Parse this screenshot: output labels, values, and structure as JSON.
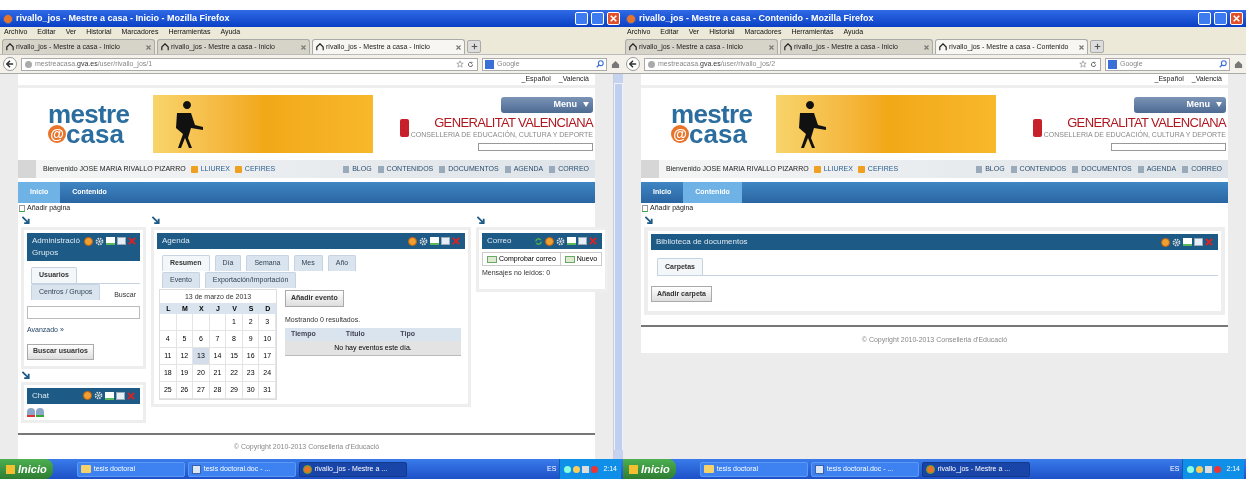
{
  "windows": [
    {
      "title": "rivallo_jos - Mestre a casa - Inicio - Mozilla Firefox",
      "menu": [
        "Archivo",
        "Editar",
        "Ver",
        "Historial",
        "Marcadores",
        "Herramientas",
        "Ayuda"
      ],
      "tabs": [
        {
          "label": "rivallo_jos - Mestre a casa - Inicio",
          "selected": false
        },
        {
          "label": "rivallo_jos - Mestre a casa - Inicio",
          "selected": false
        },
        {
          "label": "rivallo_jos - Mestre a casa - Inicio",
          "selected": true
        }
      ],
      "url": "mestreacasa.**gva.es**/user/rivallo_jos/1",
      "search_placeholder": "Google",
      "languages": [
        "_Español",
        "_Valencià"
      ],
      "menu_button": "Menu",
      "logo": {
        "line1": "mestre",
        "at": "@",
        "line2": "casa"
      },
      "gva": {
        "name": "GENERALITAT VALENCIANA",
        "sub": "CONSELLERIA DE EDUCACIÓN, CULTURA Y DEPORTE"
      },
      "welcome": "Bienvenido JOSE MARIA RIVALLO PIZARRO",
      "welcome_links": [
        "LLIUREX",
        "CEFIRES"
      ],
      "toolbar_links": [
        "BLOG",
        "CONTENIDOS",
        "DOCUMENTOS",
        "AGENDA",
        "CORREO"
      ],
      "nav": [
        {
          "label": "Inicio",
          "selected": true
        },
        {
          "label": "Contenido",
          "selected": false
        }
      ],
      "add_page": "Añadir página",
      "content": {
        "kind": "dashboard",
        "admin": {
          "title": "Administració",
          "title_line2": "Grupos",
          "tabs": [
            {
              "label": "Usuarios",
              "selected": true
            },
            {
              "label": "Centros / Grupos",
              "selected": false
            }
          ],
          "search_label": "Buscar",
          "advanced_link": "Avanzado »",
          "button": "Buscar usuarios"
        },
        "chat": {
          "title": "Chat"
        },
        "agenda": {
          "title": "Agenda",
          "tabs": [
            {
              "label": "Resumen",
              "selected": true
            },
            {
              "label": "Día",
              "selected": false
            },
            {
              "label": "Semana",
              "selected": false
            },
            {
              "label": "Mes",
              "selected": false
            },
            {
              "label": "Año",
              "selected": false
            },
            {
              "label": "Evento",
              "selected": false
            },
            {
              "label": "Exportación/Importación",
              "selected": false
            }
          ],
          "calendar": {
            "caption": "13 de marzo de 2013",
            "weekdays": [
              "L",
              "M",
              "X",
              "J",
              "V",
              "S",
              "D"
            ],
            "weeks": [
              [
                {
                  "label": "1",
                  "selected": false
                },
                {
                  "label": "2",
                  "selected": false
                },
                {
                  "label": "3",
                  "selected": false
                }
              ],
              [
                {
                  "label": "4",
                  "selected": false
                },
                {
                  "label": "5",
                  "selected": false
                },
                {
                  "label": "6",
                  "selected": false
                },
                {
                  "label": "7",
                  "selected": false
                },
                {
                  "label": "8",
                  "selected": false
                },
                {
                  "label": "9",
                  "selected": false
                },
                {
                  "label": "10",
                  "selected": false
                }
              ],
              [
                {
                  "label": "11",
                  "selected": false
                },
                {
                  "label": "12",
                  "selected": false
                },
                {
                  "label": "13",
                  "selected": true
                },
                {
                  "label": "14",
                  "selected": false
                },
                {
                  "label": "15",
                  "selected": false
                },
                {
                  "label": "16",
                  "selected": false
                },
                {
                  "label": "17",
                  "selected": false
                }
              ],
              [
                {
                  "label": "18",
                  "selected": false
                },
                {
                  "label": "19",
                  "selected": false
                },
                {
                  "label": "20",
                  "selected": false
                },
                {
                  "label": "21",
                  "selected": false
                },
                {
                  "label": "22",
                  "selected": false
                },
                {
                  "label": "23",
                  "selected": false
                },
                {
                  "label": "24",
                  "selected": false
                }
              ],
              [
                {
                  "label": "25",
                  "selected": false
                },
                {
                  "label": "26",
                  "selected": false
                },
                {
                  "label": "27",
                  "selected": false
                },
                {
                  "label": "28",
                  "selected": false
                },
                {
                  "label": "29",
                  "selected": false
                },
                {
                  "label": "30",
                  "selected": false
                },
                {
                  "label": "31",
                  "selected": false
                }
              ]
            ]
          },
          "add_button": "Añadir evento",
          "results": "Mostrando 0 resultados.",
          "columns": [
            "Tiempo",
            "Título",
            "Tipo"
          ],
          "empty": "No hay eventos este día."
        },
        "mail": {
          "title": "Correo",
          "buttons": [
            "Comprobar correo",
            "Nuevo"
          ],
          "unread": "Mensajes no leídos: 0"
        }
      },
      "footer": "© Copyright 2010-2013 Conselleria d'Educació",
      "taskbar": {
        "start": "Inicio",
        "items": [
          {
            "label": "tesis doctoral",
            "kind": "folder",
            "selected": false
          },
          {
            "label": "tesis doctoral.doc - ...",
            "kind": "document",
            "selected": false
          },
          {
            "label": "rivallo_jos - Mestre a ...",
            "kind": "browser",
            "selected": true
          }
        ],
        "language": "ES",
        "time": "2:14"
      }
    },
    {
      "title": "rivallo_jos - Mestre a casa - Contenido - Mozilla Firefox",
      "menu": [
        "Archivo",
        "Editar",
        "Ver",
        "Historial",
        "Marcadores",
        "Herramientas",
        "Ayuda"
      ],
      "tabs": [
        {
          "label": "rivallo_jos - Mestre a casa - Inicio",
          "selected": false
        },
        {
          "label": "rivallo_jos - Mestre a casa - Inicio",
          "selected": false
        },
        {
          "label": "rivallo_jos - Mestre a casa - Contenido",
          "selected": true
        }
      ],
      "url": "mestreacasa.**gva.es**/user/rivallo_jos/2",
      "search_placeholder": "Google",
      "languages": [
        "_Español",
        "_Valencià"
      ],
      "menu_button": "Menu",
      "logo": {
        "line1": "mestre",
        "at": "@",
        "line2": "casa"
      },
      "gva": {
        "name": "GENERALITAT VALENCIANA",
        "sub": "CONSELLERIA DE EDUCACIÓN, CULTURA Y DEPORTE"
      },
      "welcome": "Bienvenido JOSE MARIA RIVALLO PIZARRO",
      "welcome_links": [
        "LLIUREX",
        "CEFIRES"
      ],
      "toolbar_links": [
        "BLOG",
        "CONTENIDOS",
        "DOCUMENTOS",
        "AGENDA",
        "CORREO"
      ],
      "nav": [
        {
          "label": "Inicio",
          "selected": false
        },
        {
          "label": "Contenido",
          "selected": true
        }
      ],
      "add_page": "Añadir página",
      "content": {
        "kind": "library",
        "library": {
          "title": "Biblioteca de documentos",
          "tabs": [
            {
              "label": "Carpetas",
              "selected": true
            }
          ],
          "button": "Añadir carpeta"
        }
      },
      "footer": "© Copyright 2010-2013 Conselleria d'Educació",
      "taskbar": {
        "start": "Inicio",
        "items": [
          {
            "label": "tesis doctoral",
            "kind": "folder",
            "selected": false
          },
          {
            "label": "tesis doctoral.doc - ...",
            "kind": "document",
            "selected": false
          },
          {
            "label": "rivallo_jos - Mestre a ...",
            "kind": "browser",
            "selected": true
          }
        ],
        "language": "ES",
        "time": "2:14"
      }
    }
  ]
}
